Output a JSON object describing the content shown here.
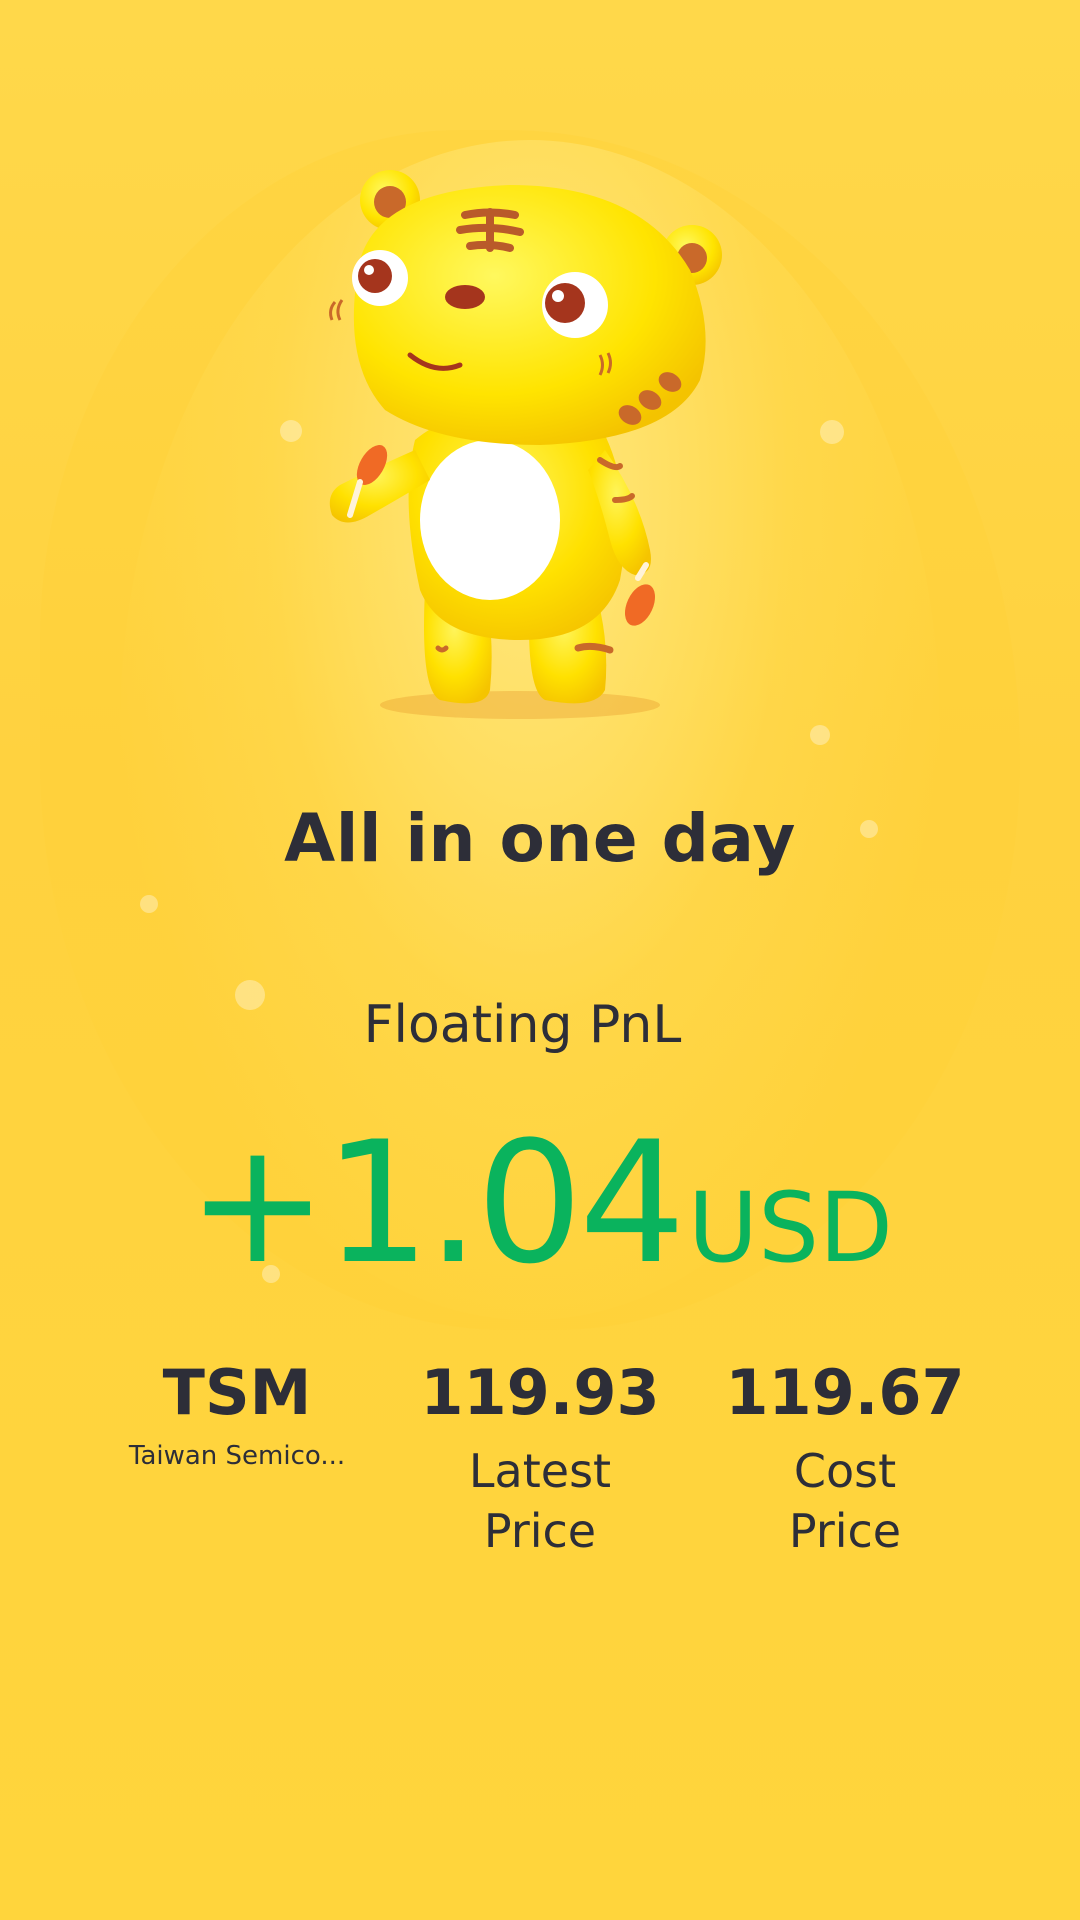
{
  "hero": {
    "mascot_icon": "tiger-mascot",
    "title": "All in one day"
  },
  "pnl": {
    "label": "Floating PnL",
    "value": "+1.04",
    "currency": "USD",
    "color": "#0ab35d"
  },
  "stats": {
    "symbol": "TSM",
    "company": "Taiwan Semico...",
    "latest_price": "119.93",
    "latest_price_label": "Latest Price",
    "cost_price": "119.67",
    "cost_price_label": "Cost Price"
  },
  "colors": {
    "background": "#ffd53c",
    "text": "#2d2e38",
    "positive": "#0ab35d"
  }
}
